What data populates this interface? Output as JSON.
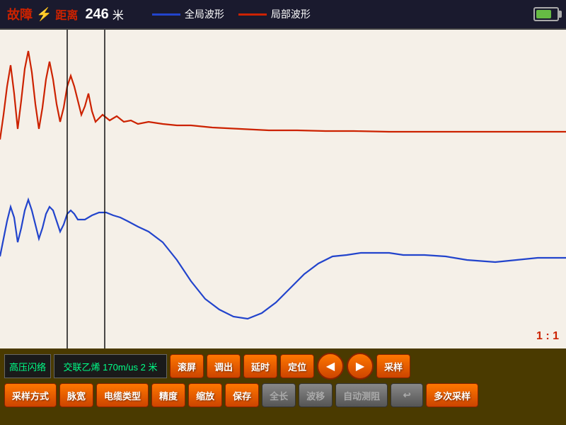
{
  "header": {
    "fault_label": "故障",
    "lightning_icon": "⚡",
    "distance_label": "距离",
    "distance_value": "246",
    "unit": "米",
    "legend": [
      {
        "id": "global",
        "label": "全局波形",
        "color": "blue"
      },
      {
        "id": "local",
        "label": "局部波形",
        "color": "red"
      }
    ]
  },
  "chart": {
    "ratio": "1 : 1",
    "background": "#f5f0e8"
  },
  "controls": {
    "row1": {
      "info_voltage": "高压闪络",
      "info_cable": "交联乙烯  170m/us  2 米",
      "btn_scroll": "滚屏",
      "btn_tune": "调出",
      "btn_delay": "延时",
      "btn_locate": "定位",
      "btn_prev_icon": "◀",
      "btn_next_icon": "▶",
      "btn_sample": "采样"
    },
    "row2": {
      "btn_sample_mode": "采样方式",
      "btn_pulse_width": "脉宽",
      "btn_cable_type": "电缆类型",
      "btn_precision": "精度",
      "btn_zoom": "缩放",
      "btn_save": "保存",
      "btn_full": "全长",
      "btn_wave_move": "波移",
      "btn_auto_match": "自动测阻",
      "btn_back_icon": "↩",
      "btn_multi_sample": "多次采样"
    }
  }
}
